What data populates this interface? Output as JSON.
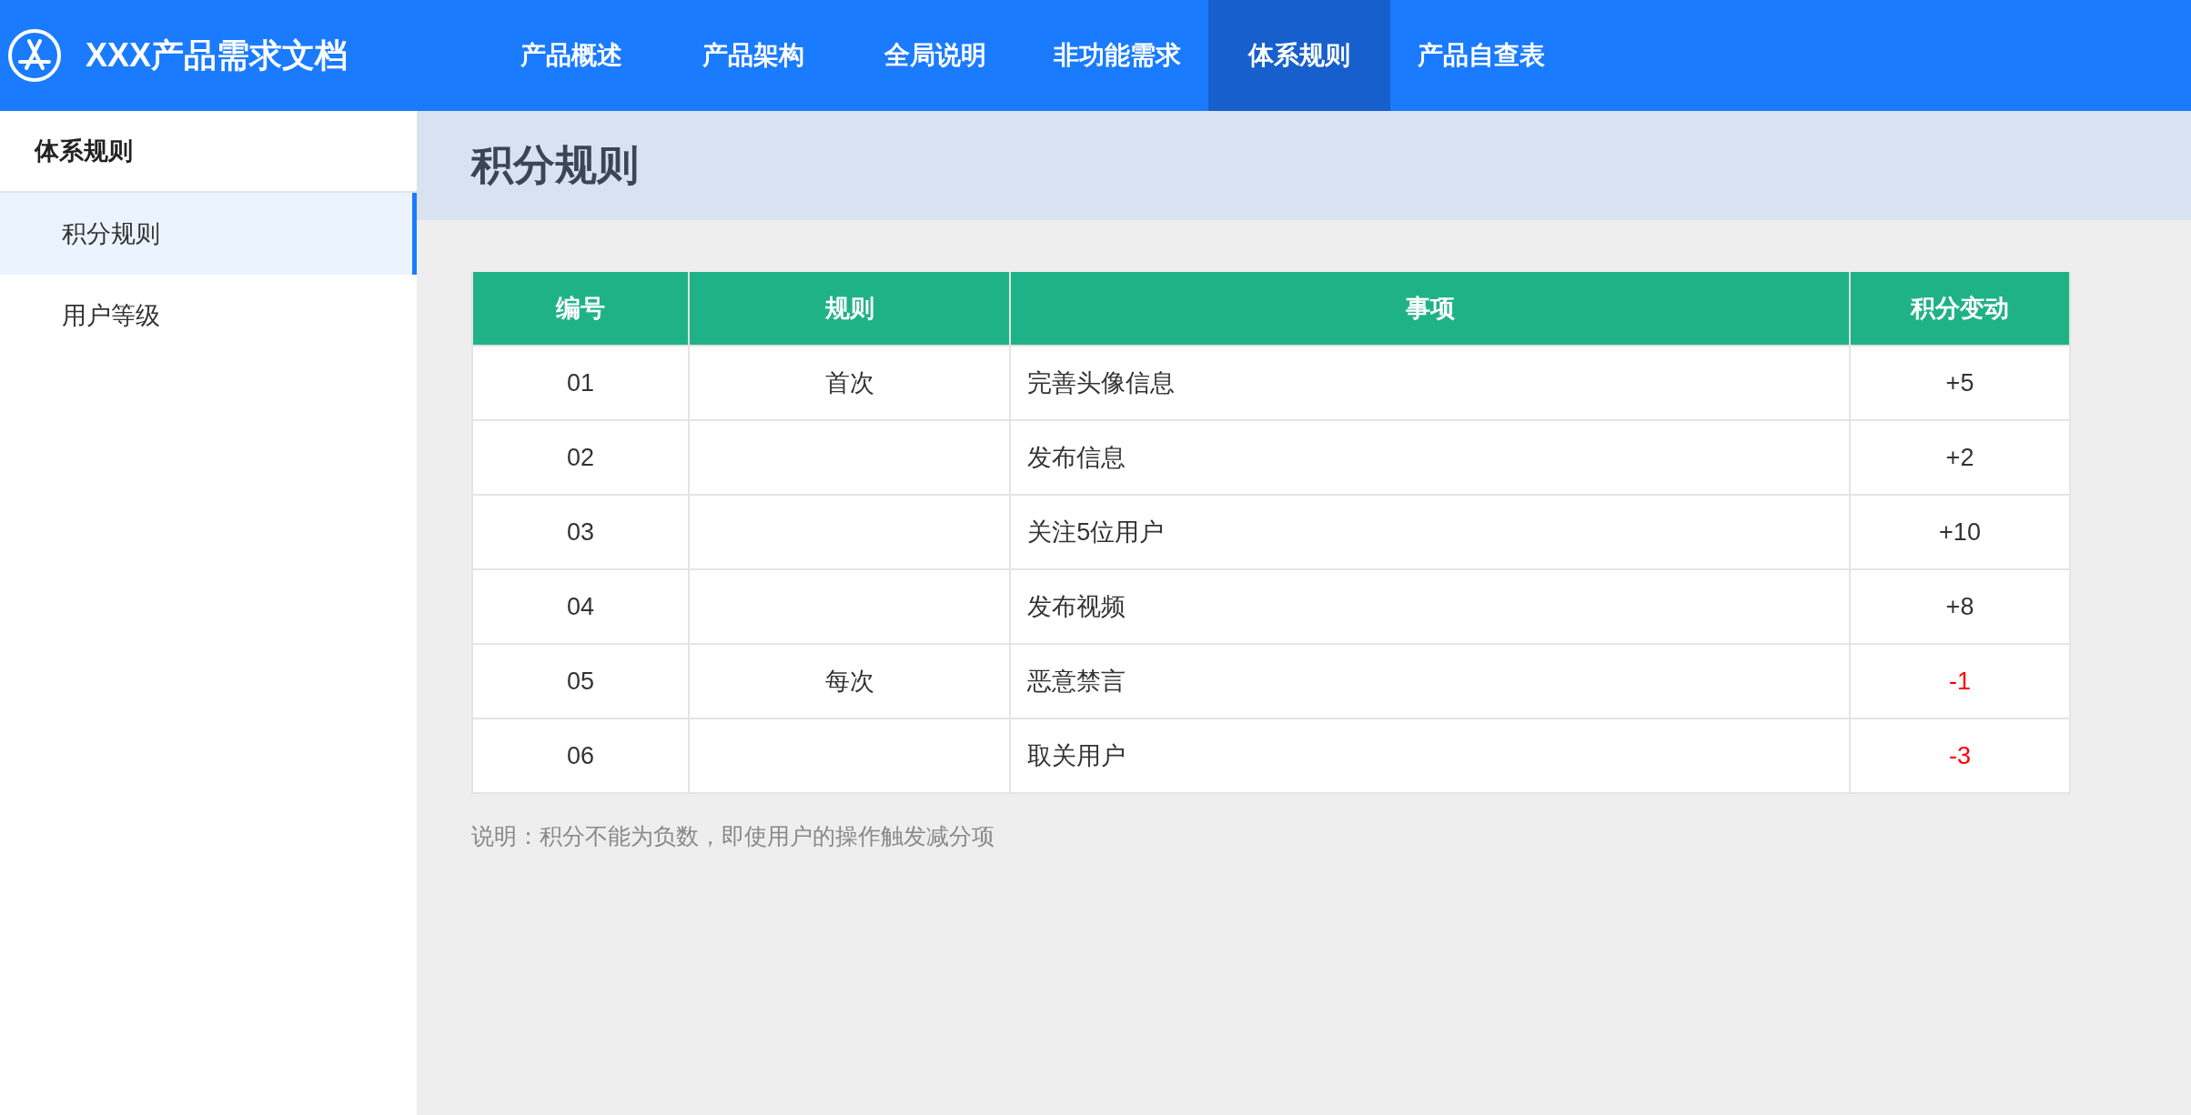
{
  "header": {
    "title": "XXX产品需求文档",
    "nav": [
      {
        "label": "产品概述",
        "selected": false
      },
      {
        "label": "产品架构",
        "selected": false
      },
      {
        "label": "全局说明",
        "selected": false
      },
      {
        "label": "非功能需求",
        "selected": false
      },
      {
        "label": "体系规则",
        "selected": true
      },
      {
        "label": "产品自查表",
        "selected": false
      }
    ]
  },
  "sidebar": {
    "heading": "体系规则",
    "items": [
      {
        "label": "积分规则",
        "selected": true
      },
      {
        "label": "用户等级",
        "selected": false
      }
    ]
  },
  "page_title": "积分规则",
  "table": {
    "columns": [
      "编号",
      "规则",
      "事项",
      "积分变动"
    ],
    "rows": [
      {
        "id": "01",
        "rule": "首次",
        "item": "完善头像信息",
        "change": "+5",
        "color": "#333333"
      },
      {
        "id": "02",
        "item": "发布信息",
        "change": "+2",
        "color": "#333333"
      },
      {
        "id": "03",
        "item": "关注5位用户",
        "change": "+10",
        "color": "#333333"
      },
      {
        "id": "04",
        "item": "发布视频",
        "change": "+8",
        "color": "#333333"
      },
      {
        "id": "05",
        "rule": "每次",
        "item": "恶意禁言",
        "change": "-1",
        "color": "#ff0000"
      },
      {
        "id": "06",
        "item": "取关用户",
        "change": "-3",
        "color": "#ff0000"
      }
    ]
  },
  "note": "说明：积分不能为负数，即使用户的操作触发减分项"
}
